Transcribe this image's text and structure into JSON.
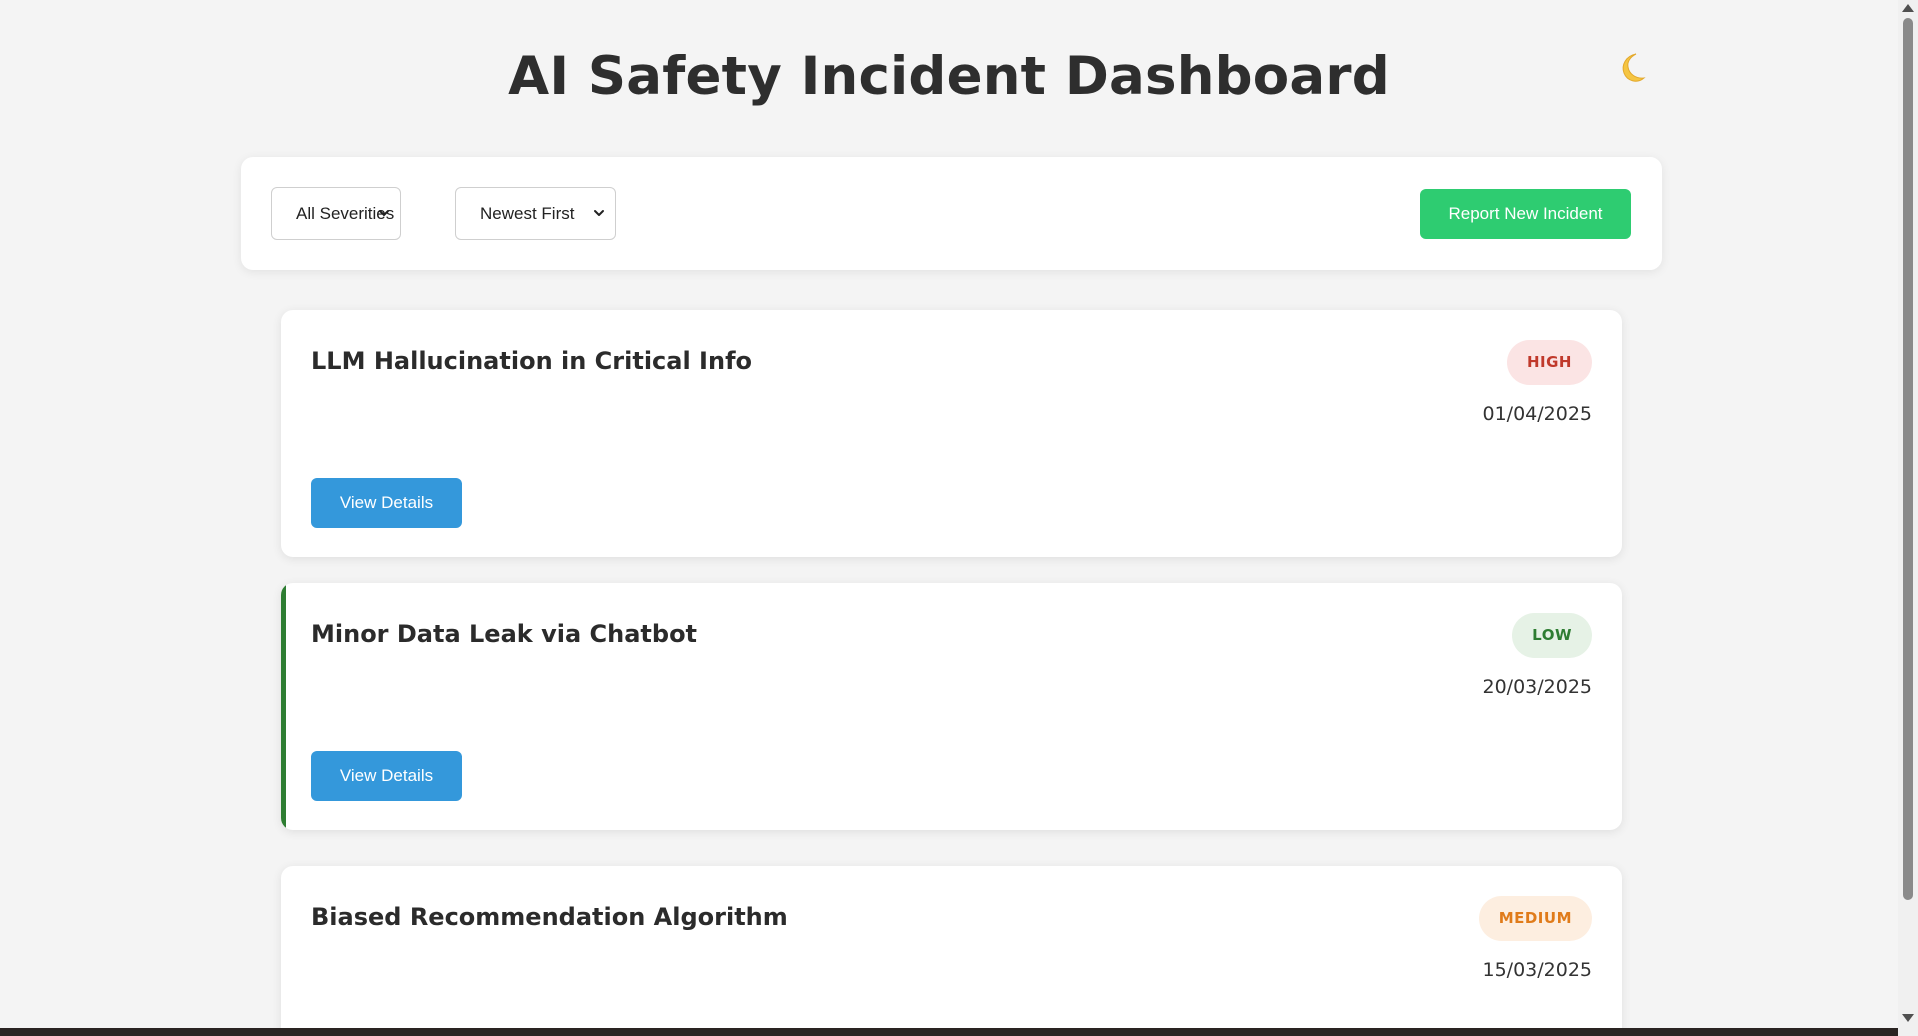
{
  "header": {
    "title": "AI Safety Incident Dashboard",
    "theme_toggle_icon": "crescent-moon-icon"
  },
  "controls": {
    "severity_filter": {
      "selected": "All Severities"
    },
    "sort_order": {
      "selected": "Newest First"
    },
    "report_button_label": "Report New Incident",
    "report_button_color": "#2ecc71"
  },
  "incidents": [
    {
      "title": "LLM Hallucination in Critical Info",
      "severity": "HIGH",
      "date": "01/04/2025",
      "button_label": "View Details"
    },
    {
      "title": "Minor Data Leak via Chatbot",
      "severity": "LOW",
      "date": "20/03/2025",
      "button_label": "View Details"
    },
    {
      "title": "Biased Recommendation Algorithm",
      "severity": "MEDIUM",
      "date": "15/03/2025"
    }
  ],
  "colors": {
    "background": "#f4f4f4",
    "view_button": "#3498db",
    "high_badge_text": "#c0392b",
    "high_badge_bg": "#fbe4e4",
    "low_badge_text": "#2e7d32",
    "low_badge_bg": "#e6f2e6",
    "medium_badge_text": "#e07b1a",
    "medium_badge_bg": "#fdeee0",
    "low_accent_border": "#2e7d32"
  }
}
